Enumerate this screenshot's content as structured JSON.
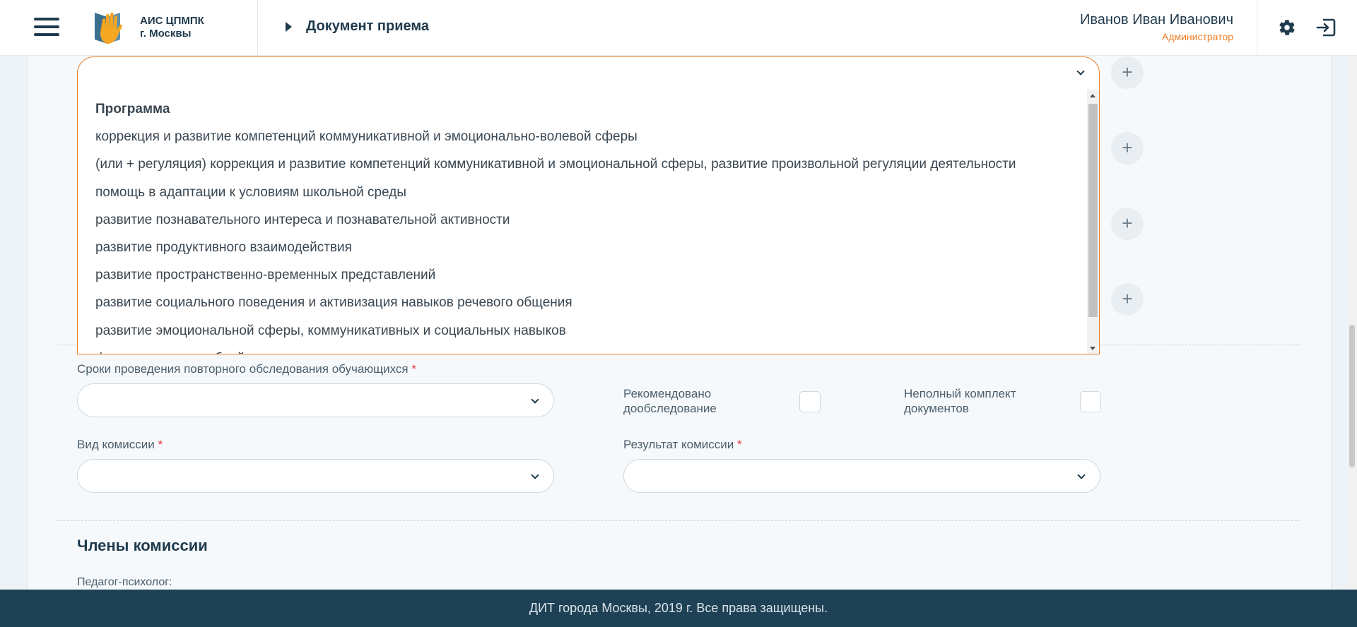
{
  "header": {
    "logo_line1": "АИС ЦПМПК",
    "logo_line2": "г. Москвы",
    "page_title": "Документ приема",
    "user_name": "Иванов Иван Иванович",
    "user_role": "Администратор",
    "icons": [
      "menu-icon",
      "logo-hand-icon",
      "gear-icon",
      "logout-icon"
    ]
  },
  "dropdown": {
    "value": "",
    "items": [
      "Программа",
      "коррекция и развитие компетенций коммуникативной и эмоционально-волевой сферы",
      "(или + регуляция) коррекция и развитие компетенций коммуникативной и эмоциональной сферы, развитие произвольной регуляции деятельности",
      "помощь в адаптации к условиям школьной среды",
      "развитие познавательного интереса и познавательной активности",
      "развитие продуктивного взаимодействия",
      "развитие пространственно-временных представлений",
      "развитие социального поведения и активизация навыков речевого общения",
      "развитие эмоциональной сферы, коммуникативных и социальных навыков",
      "формирование учебной..."
    ]
  },
  "plus_buttons": [
    "+",
    "+",
    "+",
    "+"
  ],
  "form": {
    "repeat_exam_label": "Сроки проведения повторного обследования обучающихся",
    "repeat_exam_value": "",
    "recommended_label_line1": "Рекомендовано",
    "recommended_label_line2": "дообследование",
    "incomplete_label_line1": "Неполный комплект",
    "incomplete_label_line2": "документов",
    "commission_type_label": "Вид комиссии",
    "commission_type_value": "",
    "commission_result_label": "Результат комиссии",
    "commission_result_value": "",
    "required_mark": "*"
  },
  "members": {
    "title": "Члены комиссии",
    "first_role": "Педагог-психолог:"
  },
  "footer": {
    "text": "ДИТ города Москвы, 2019 г. Все права защищены."
  },
  "colors": {
    "accent": "#f07e26",
    "header_text": "#1f3a4d",
    "footer_bg": "#1e4155",
    "required": "#e53935"
  }
}
